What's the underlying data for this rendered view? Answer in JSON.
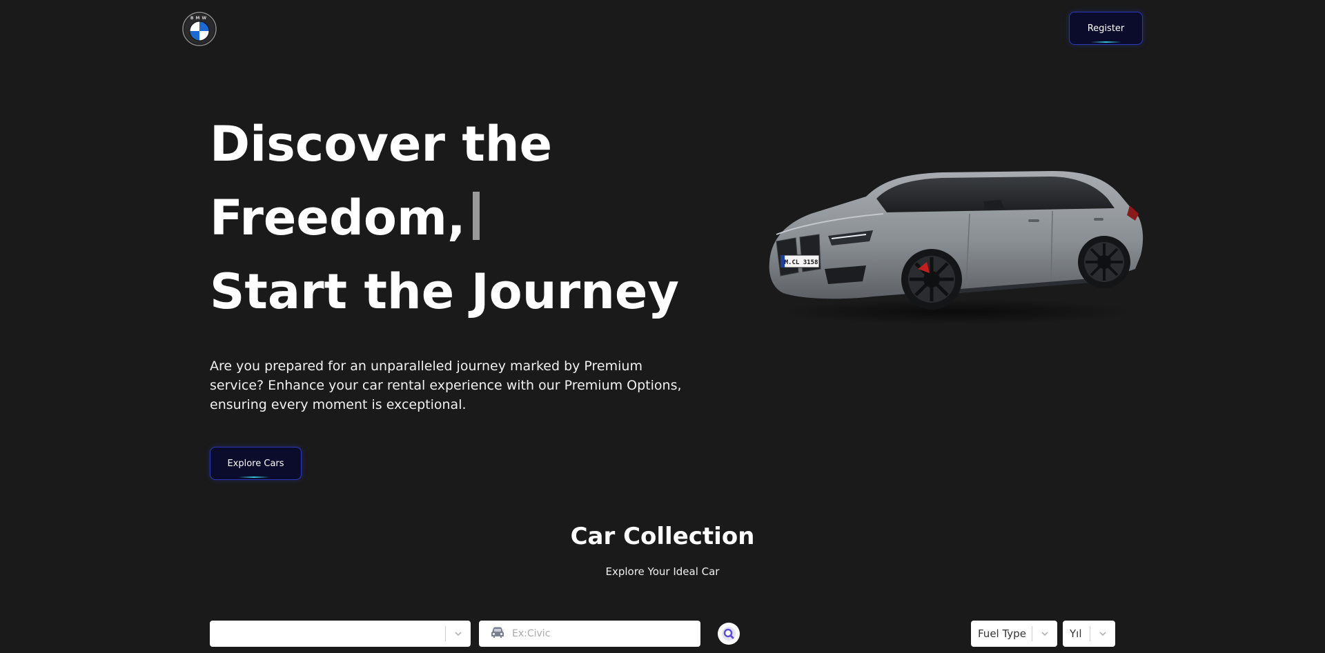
{
  "header": {
    "logo_letters": "BMW",
    "register_label": "Register"
  },
  "hero": {
    "title_lines": [
      "Discover the",
      "Freedom,",
      "Start the Journey"
    ],
    "description": "Are you prepared for an unparalleled journey marked by Premium service? Enhance your car rental experience with our Premium Options, ensuring every moment is exceptional.",
    "explore_label": "Explore Cars",
    "car_plate": "M.CL 3158"
  },
  "collection": {
    "title": "Car Collection",
    "subtitle": "Explore Your Ideal Car"
  },
  "filters": {
    "make_value": "",
    "model_placeholder": "Ex:Civic",
    "fuel_label": "Fuel Type",
    "year_label": "Yıl"
  },
  "colors": {
    "background": "#1a1a1b",
    "button_bg": "#0b0c2c",
    "button_border": "#2b3bb8",
    "button_glow": "#39c6d8",
    "logo_blue": "#1c69d4"
  },
  "icons": {
    "logo": "bmw-roundel-icon",
    "model": "car-icon",
    "search": "magnifier-icon",
    "dropdown": "chevron-down-icon"
  }
}
